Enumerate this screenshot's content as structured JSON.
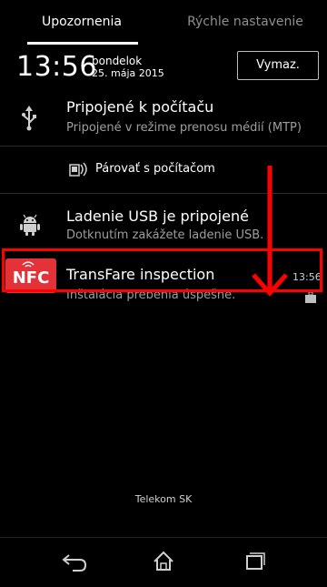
{
  "tabs": [
    {
      "label": "Upozornenia",
      "active": true
    },
    {
      "label": "Rýchle nastavenie",
      "active": false
    }
  ],
  "clock": {
    "time": "13:56",
    "day": "pondelok",
    "date": "25. mája 2015"
  },
  "clear_button": {
    "label": "Vymaz."
  },
  "notifications": [
    {
      "icon": "usb-icon",
      "title": "Pripojené k počítaču",
      "subtitle": "Pripojené v režime prenosu médií (MTP)"
    },
    {
      "icon": "pairing-icon",
      "title": "Párovať s počítačom"
    },
    {
      "icon": "android-icon",
      "title": "Ladenie USB je pripojené",
      "subtitle": "Dotknutím zakážete ladenie USB."
    },
    {
      "icon": "nfc-icon",
      "icon_text": "NFC",
      "title": "TransFare inspection",
      "subtitle": "Inštalácia prebehla úspešne.",
      "time": "13:56",
      "badge_icon": "briefcase-icon"
    }
  ],
  "carrier": "Telekom SK",
  "navigation": [
    "back-icon",
    "home-icon",
    "recents-icon"
  ],
  "colors": {
    "highlight": "#ff0000",
    "nfc_brand": "#e53238",
    "background": "#000000"
  }
}
